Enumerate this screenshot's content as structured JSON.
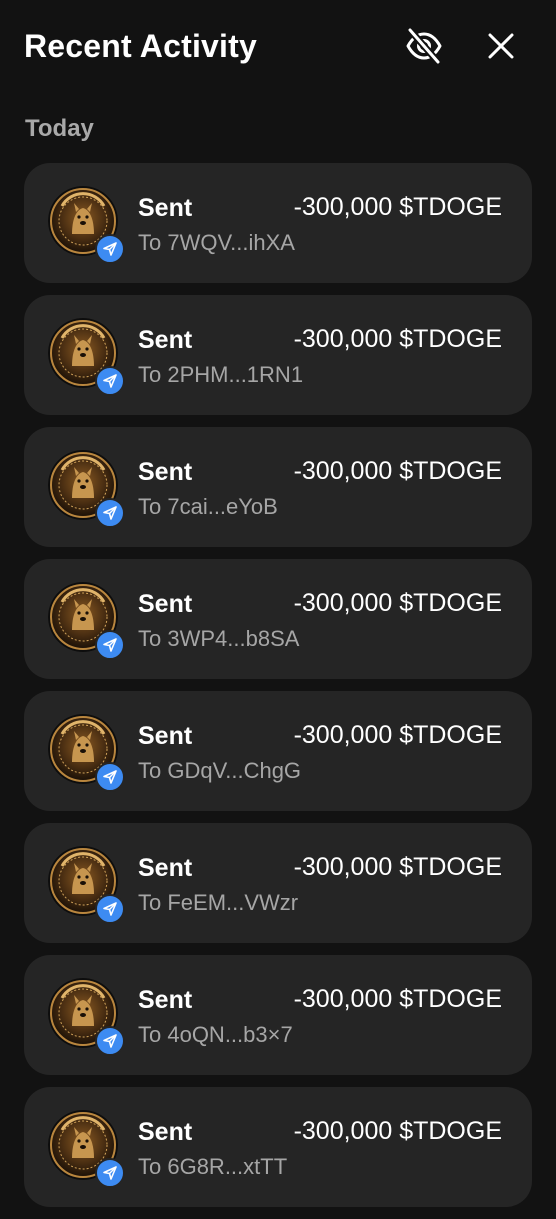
{
  "header": {
    "title": "Recent Activity",
    "hide_icon": "eye-off-icon",
    "close_icon": "close-icon"
  },
  "section": {
    "label": "Today"
  },
  "colors": {
    "background": "#121212",
    "card": "#252525",
    "badge": "#3d8bf2",
    "secondary_text": "#a6a6a6"
  },
  "transactions": [
    {
      "type": "Sent",
      "amount": "-300,000 $TDOGE",
      "to": "To 7WQV...ihXA"
    },
    {
      "type": "Sent",
      "amount": "-300,000 $TDOGE",
      "to": "To 2PHM...1RN1"
    },
    {
      "type": "Sent",
      "amount": "-300,000 $TDOGE",
      "to": "To 7cai...eYoB"
    },
    {
      "type": "Sent",
      "amount": "-300,000 $TDOGE",
      "to": "To 3WP4...b8SA"
    },
    {
      "type": "Sent",
      "amount": "-300,000 $TDOGE",
      "to": "To GDqV...ChgG"
    },
    {
      "type": "Sent",
      "amount": "-300,000 $TDOGE",
      "to": "To FeEM...VWzr"
    },
    {
      "type": "Sent",
      "amount": "-300,000 $TDOGE",
      "to": "To 4oQN...b3×7"
    },
    {
      "type": "Sent",
      "amount": "-300,000 $TDOGE",
      "to": "To 6G8R...xtTT"
    }
  ]
}
